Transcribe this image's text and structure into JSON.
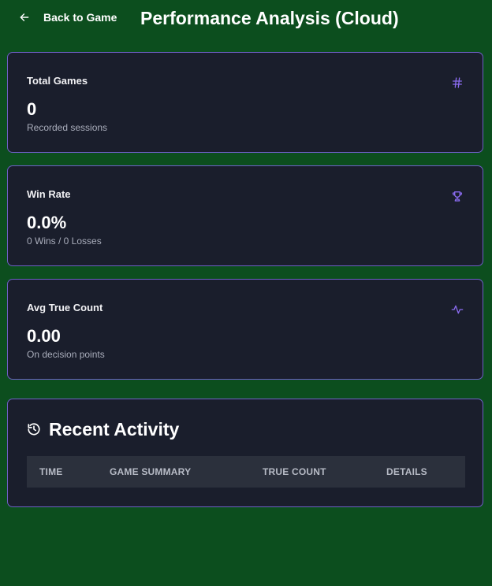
{
  "header": {
    "back_label": "Back to Game",
    "title": "Performance Analysis (Cloud)"
  },
  "stats": [
    {
      "label": "Total Games",
      "value": "0",
      "sub": "Recorded sessions",
      "icon": "hash-icon"
    },
    {
      "label": "Win Rate",
      "value": "0.0%",
      "sub": "0 Wins / 0 Losses",
      "icon": "trophy-icon"
    },
    {
      "label": "Avg True Count",
      "value": "0.00",
      "sub": "On decision points",
      "icon": "activity-icon"
    }
  ],
  "activity": {
    "title": "Recent Activity",
    "columns": [
      "TIME",
      "GAME SUMMARY",
      "TRUE COUNT",
      "DETAILS"
    ]
  },
  "colors": {
    "background": "#0c4e1e",
    "card": "#1a1e2c",
    "card_border": "#6e5fc6",
    "accent": "#8b6cf0",
    "table_header": "#2b303c"
  }
}
